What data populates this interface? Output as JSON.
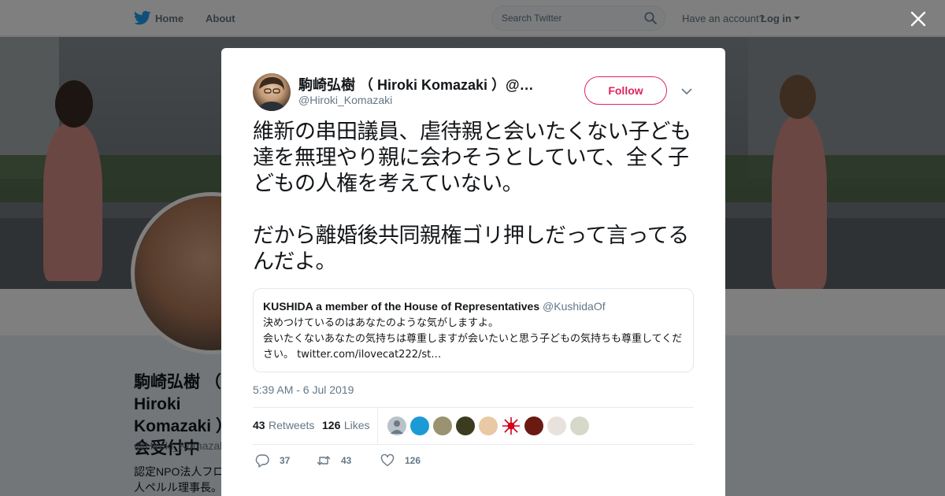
{
  "nav": {
    "home_label": "Home",
    "about_label": "About",
    "search_placeholder": "Search Twitter",
    "have_account": "Have an account?",
    "login_label": "Log in",
    "brand_color": "#1da1f2"
  },
  "profile": {
    "name": "駒崎弘樹 （ Hiroki Komazaki ）会受付中",
    "handle": "@Hiroki_Komazaki",
    "bio": "認定NPO法人フロ人ペルル理事長。"
  },
  "tweet": {
    "author_name": "駒崎弘樹 （ Hiroki Komazaki ）@…",
    "author_handle": "@Hiroki_Komazaki",
    "follow_label": "Follow",
    "text": "維新の串田議員、虐待親と会いたくない子ども達を無理やり親に会わそうとしていて、全く子どもの人権を考えていない。\n\nだから離婚後共同親権ゴリ押しだって言ってるんだよ。",
    "quote": {
      "name": "KUSHIDA a member of the House of Representatives",
      "handle": "@KushidaOf",
      "text": "決めつけているのはあなたのような気がしますよ。\n会いたくないあなたの気持ちは尊重しますが会いたいと思う子どもの気持ちも尊重してください。 twitter.com/ilovecat222/st…"
    },
    "timestamp": "5:39 AM - 6 Jul 2019",
    "retweets_count": "43",
    "retweets_label": "Retweets",
    "likes_count": "126",
    "likes_label": "Likes",
    "actions": {
      "reply_count": "37",
      "retweet_count": "43",
      "like_count": "126"
    },
    "follow_color": "#e0245e"
  }
}
